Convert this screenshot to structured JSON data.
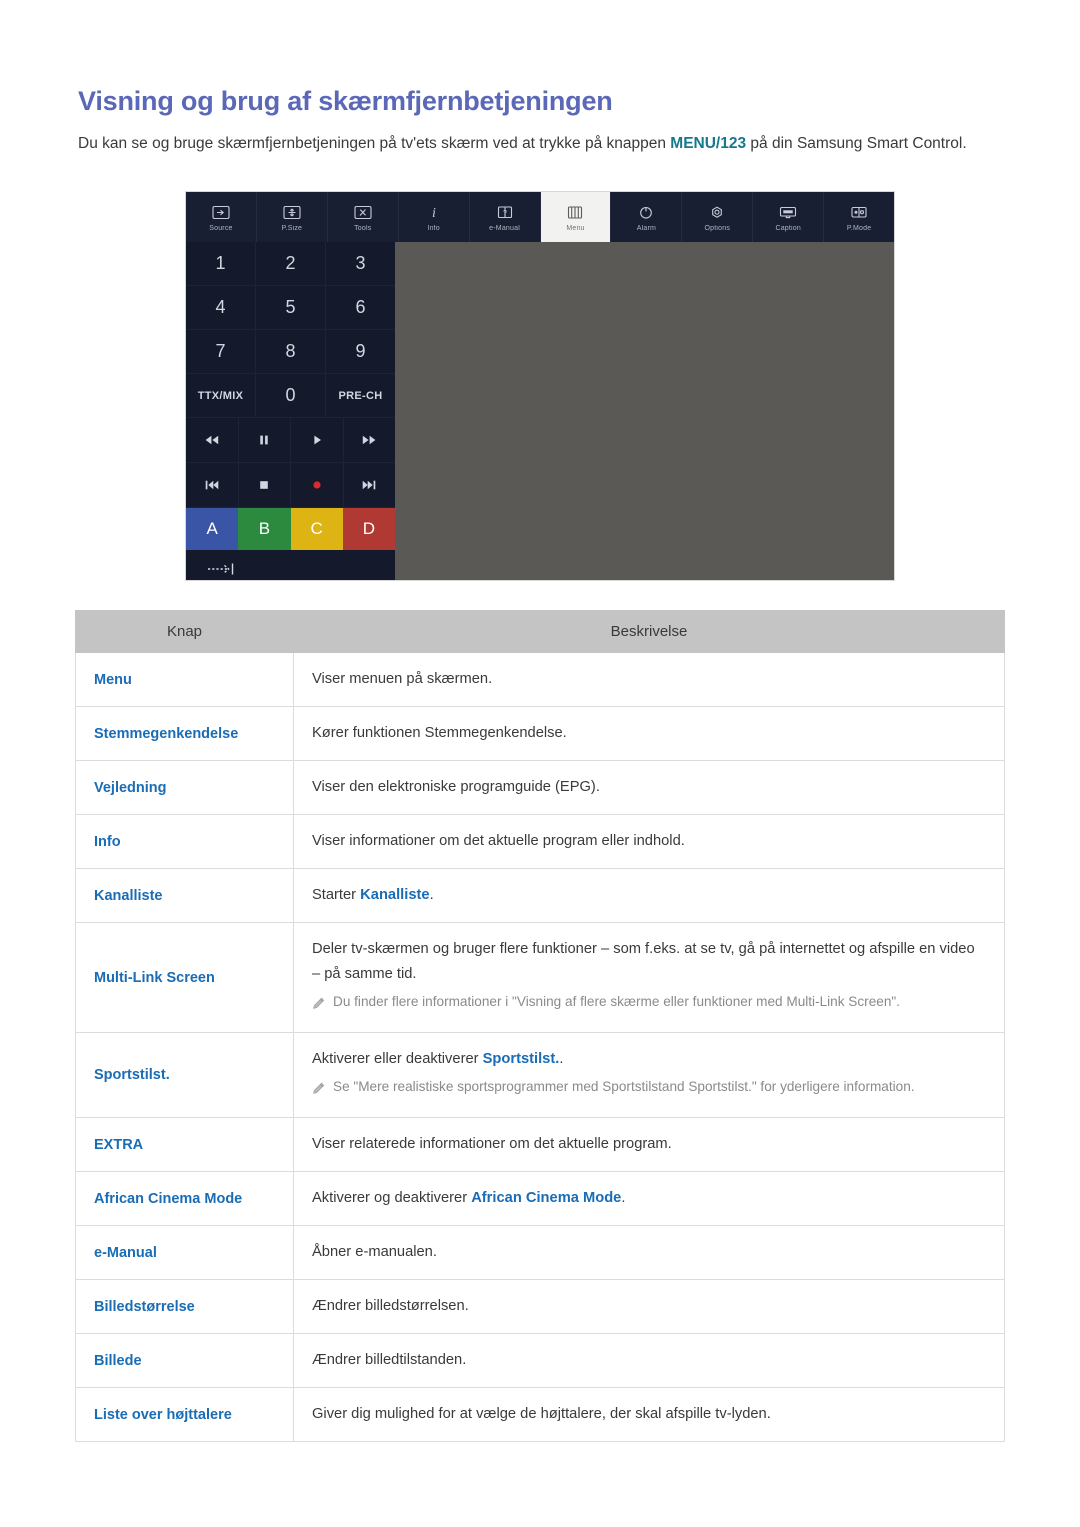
{
  "page": {
    "title": "Visning og brug af skærmfjernbetjeningen",
    "intro_before": "Du kan se og bruge skærmfjernbetjeningen på tv'ets skærm ved at trykke på knappen ",
    "intro_keyword": "MENU/123",
    "intro_after": " på din Samsung Smart Control."
  },
  "colors": {
    "heading": "#5b68b8",
    "link": "#1a6cb5",
    "keyword": "#16798b",
    "table_header_bg": "#c4c4c4",
    "remote_panel": "#5a5956",
    "remote_dark": "#141a2b",
    "color_a": "#3a55a6",
    "color_b": "#2b8a3e",
    "color_c": "#ddb414",
    "color_d": "#b03a33"
  },
  "remote": {
    "toolbar": [
      {
        "label": "Source",
        "icon": "source-icon",
        "active": false
      },
      {
        "label": "P.Size",
        "icon": "psize-icon",
        "active": false
      },
      {
        "label": "Tools",
        "icon": "tools-icon",
        "active": false
      },
      {
        "label": "Info",
        "icon": "info-icon",
        "active": false
      },
      {
        "label": "e-Manual",
        "icon": "emanual-icon",
        "active": false
      },
      {
        "label": "Menu",
        "icon": "menu-icon",
        "active": true
      },
      {
        "label": "Alarm",
        "icon": "alarm-icon",
        "active": false
      },
      {
        "label": "Options",
        "icon": "options-icon",
        "active": false
      },
      {
        "label": "Caption",
        "icon": "caption-icon",
        "active": false
      },
      {
        "label": "P.Mode",
        "icon": "pmode-icon",
        "active": false
      }
    ],
    "keypad": [
      [
        "1",
        "2",
        "3"
      ],
      [
        "4",
        "5",
        "6"
      ],
      [
        "7",
        "8",
        "9"
      ],
      [
        "TTX/MIX",
        "0",
        "PRE-CH"
      ]
    ],
    "media_row_1": [
      "rewind-icon",
      "pause-icon",
      "play-icon",
      "fast-forward-icon"
    ],
    "media_row_2": [
      "previous-icon",
      "stop-icon",
      "record-icon",
      "next-icon"
    ],
    "color_buttons": [
      "A",
      "B",
      "C",
      "D"
    ],
    "exit_icon": "exit-arrow-icon"
  },
  "table": {
    "headers": [
      "Knap",
      "Beskrivelse"
    ],
    "rows": [
      {
        "key": "Menu",
        "desc_parts": [
          {
            "t": "Viser menuen på skærmen.",
            "link": false
          }
        ]
      },
      {
        "key": "Stemmegenkendelse",
        "desc_parts": [
          {
            "t": "Kører funktionen Stemmegenkendelse.",
            "link": false
          }
        ]
      },
      {
        "key": "Vejledning",
        "desc_parts": [
          {
            "t": "Viser den elektroniske programguide (EPG).",
            "link": false
          }
        ]
      },
      {
        "key": "Info",
        "desc_parts": [
          {
            "t": "Viser informationer om det aktuelle program eller indhold.",
            "link": false
          }
        ]
      },
      {
        "key": "Kanalliste",
        "desc_parts": [
          {
            "t": "Starter ",
            "link": false
          },
          {
            "t": "Kanalliste",
            "link": true
          },
          {
            "t": ".",
            "link": false
          }
        ]
      },
      {
        "key": "Multi-Link Screen",
        "desc_parts": [
          {
            "t": "Deler tv-skærmen og bruger flere funktioner – som f.eks. at se tv, gå på internettet og afspille en video – på samme tid.",
            "link": false
          }
        ],
        "note": "Du finder flere informationer i \"Visning af flere skærme eller funktioner med Multi-Link Screen\"."
      },
      {
        "key": "Sportstilst.",
        "desc_parts": [
          {
            "t": "Aktiverer eller deaktiverer ",
            "link": false
          },
          {
            "t": "Sportstilst.",
            "link": true
          },
          {
            "t": ".",
            "link": false
          }
        ],
        "note": "Se \"Mere realistiske sportsprogrammer med Sportstilstand Sportstilst.\" for yderligere information."
      },
      {
        "key": "EXTRA",
        "desc_parts": [
          {
            "t": "Viser relaterede informationer om det aktuelle program.",
            "link": false
          }
        ]
      },
      {
        "key": "African Cinema Mode",
        "desc_parts": [
          {
            "t": "Aktiverer og deaktiverer ",
            "link": false
          },
          {
            "t": "African Cinema Mode",
            "link": true
          },
          {
            "t": ".",
            "link": false
          }
        ]
      },
      {
        "key": "e-Manual",
        "desc_parts": [
          {
            "t": "Åbner e-manualen.",
            "link": false
          }
        ]
      },
      {
        "key": "Billedstørrelse",
        "desc_parts": [
          {
            "t": "Ændrer billedstørrelsen.",
            "link": false
          }
        ]
      },
      {
        "key": "Billede",
        "desc_parts": [
          {
            "t": "Ændrer billedtilstanden.",
            "link": false
          }
        ]
      },
      {
        "key": "Liste over højttalere",
        "desc_parts": [
          {
            "t": "Giver dig mulighed for at vælge de højttalere, der skal afspille tv-lyden.",
            "link": false
          }
        ]
      }
    ]
  }
}
